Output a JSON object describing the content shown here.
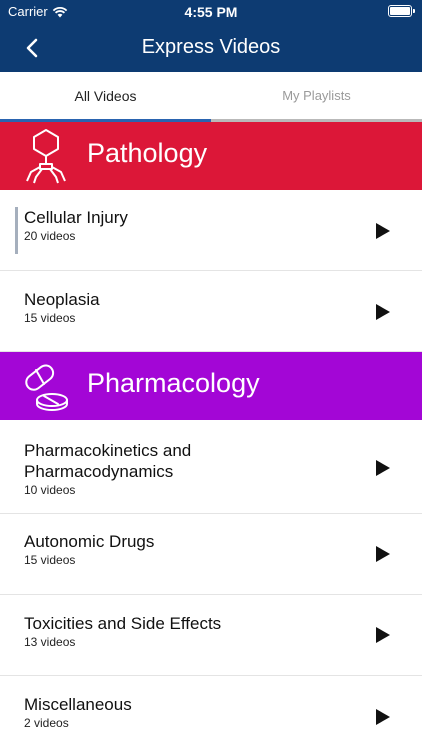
{
  "status": {
    "carrier": "Carrier",
    "time": "4:55 PM"
  },
  "header": {
    "title": "Express Videos"
  },
  "tabs": [
    {
      "label": "All Videos"
    },
    {
      "label": "My Playlists"
    }
  ],
  "sections": [
    {
      "title": "Pathology",
      "color": "#dc1738",
      "icon": "virus-icon",
      "items": [
        {
          "title": "Cellular Injury",
          "count": "20 videos"
        },
        {
          "title": "Neoplasia",
          "count": "15 videos"
        }
      ]
    },
    {
      "title": "Pharmacology",
      "color": "#a306d6",
      "icon": "pills-icon",
      "items": [
        {
          "title": "Pharmacokinetics and Pharmacodynamics",
          "count": "10 videos"
        },
        {
          "title": "Autonomic Drugs",
          "count": "15 videos"
        },
        {
          "title": "Toxicities and Side Effects",
          "count": "13 videos"
        },
        {
          "title": "Miscellaneous",
          "count": "2 videos"
        }
      ]
    }
  ],
  "colors": {
    "nav": "#0d3b72",
    "tab_active": "#2a64b0"
  }
}
